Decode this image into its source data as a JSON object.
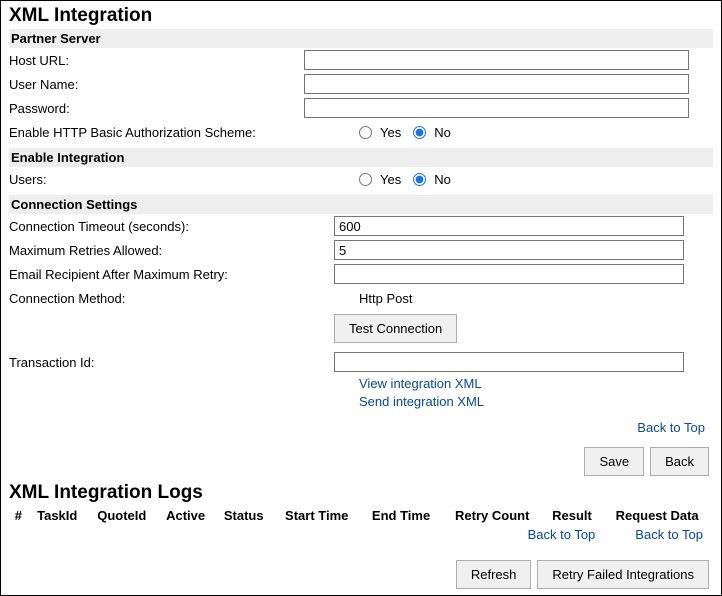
{
  "title": "XML Integration",
  "sections": {
    "partner": {
      "header": "Partner Server",
      "hostUrlLabel": "Host URL:",
      "hostUrlValue": "",
      "userNameLabel": "User Name:",
      "userNameValue": "",
      "passwordLabel": "Password:",
      "passwordValue": "",
      "authLabel": "Enable HTTP Basic Authorization Scheme:",
      "yes": "Yes",
      "no": "No",
      "authSelected": "No"
    },
    "integration": {
      "header": "Enable Integration",
      "usersLabel": "Users:",
      "yes": "Yes",
      "no": "No",
      "usersSelected": "No"
    },
    "connection": {
      "header": "Connection Settings",
      "timeoutLabel": "Connection Timeout (seconds):",
      "timeoutValue": "600",
      "retriesLabel": "Maximum Retries Allowed:",
      "retriesValue": "5",
      "emailLabel": "Email Recipient After Maximum Retry:",
      "emailValue": "",
      "methodLabel": "Connection Method:",
      "methodValue": "Http Post",
      "testBtn": "Test Connection",
      "txnLabel": "Transaction Id:",
      "txnValue": "",
      "viewXml": "View integration XML",
      "sendXml": "Send integration XML"
    }
  },
  "links": {
    "backToTop": "Back to Top"
  },
  "buttons": {
    "save": "Save",
    "back": "Back",
    "refresh": "Refresh",
    "retryFailed": "Retry Failed Integrations"
  },
  "logs": {
    "title": "XML Integration Logs",
    "columns": [
      "#",
      "TaskId",
      "QuoteId",
      "Active",
      "Status",
      "Start Time",
      "End Time",
      "Retry Count",
      "Result",
      "Request Data"
    ]
  }
}
